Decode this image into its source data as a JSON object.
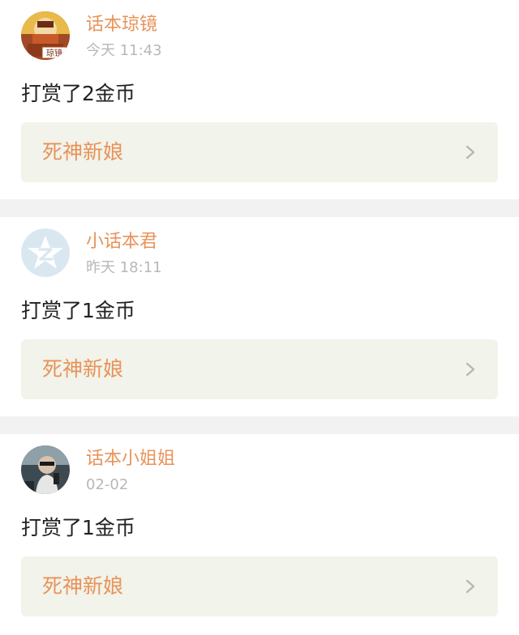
{
  "posts": [
    {
      "username": "话本琼镜",
      "time": "今天 11:43",
      "message": "打赏了2金币",
      "link_title": "死神新娘",
      "avatar_label": "琼镜"
    },
    {
      "username": "小话本君",
      "time": "昨天 18:11",
      "message": "打赏了1金币",
      "link_title": "死神新娘"
    },
    {
      "username": "话本小姐姐",
      "time": "02-02",
      "message": "打赏了1金币",
      "link_title": "死神新娘"
    }
  ],
  "colors": {
    "accent": "#e8935a",
    "link_bg": "#f2f3ea",
    "divider": "#f2f2f2",
    "timestamp": "#b8b8b8",
    "text": "#222222"
  },
  "icons": {
    "chevron": "chevron-right-icon",
    "avatar_2": "star-z-logo"
  }
}
